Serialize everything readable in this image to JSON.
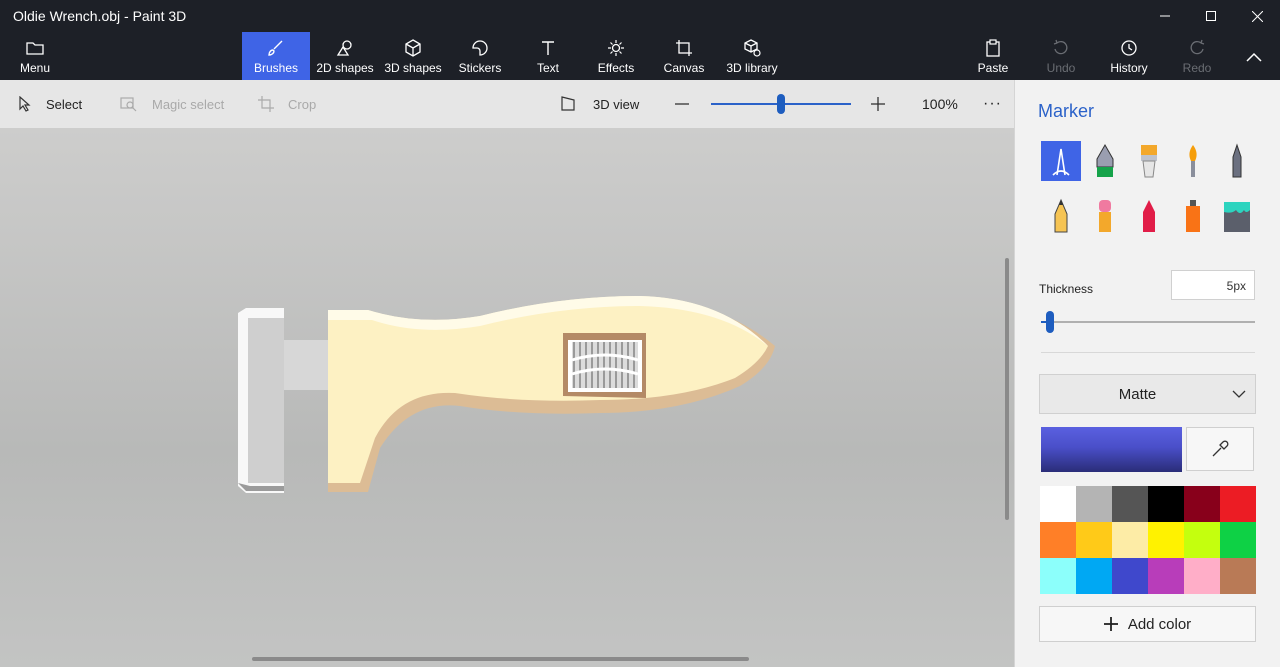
{
  "window": {
    "title": "Oldie Wrench.obj - Paint 3D"
  },
  "ribbon": {
    "menu_label": "Menu",
    "tools": [
      "Brushes",
      "2D shapes",
      "3D shapes",
      "Stickers",
      "Text",
      "Effects",
      "Canvas",
      "3D library"
    ],
    "active_tool": "Brushes",
    "right_tools": [
      "Paste",
      "Undo",
      "History",
      "Redo"
    ]
  },
  "toolbar": {
    "select_label": "Select",
    "magic_select_label": "Magic select",
    "crop_label": "Crop",
    "view3d_label": "3D view",
    "zoom_level": "100%",
    "zoom_slider_fraction": 0.5
  },
  "panel": {
    "title": "Marker",
    "brushes": [
      "marker",
      "calligraphy-pen",
      "oil-brush",
      "watercolor",
      "pixel-pen",
      "pencil",
      "eraser",
      "crayon",
      "spray-can",
      "fill"
    ],
    "selected_brush": "marker",
    "thickness_label": "Thickness",
    "thickness_value": "5px",
    "thickness_fraction": 0.04,
    "finish_value": "Matte",
    "current_color": "#4a4fc9",
    "palette": [
      "#ffffff",
      "#b4b4b4",
      "#555555",
      "#000000",
      "#88001b",
      "#ec1c24",
      "#ff7f27",
      "#ffca18",
      "#fdeca6",
      "#fff200",
      "#c4ff0e",
      "#0ed145",
      "#8cfffb",
      "#00a8f3",
      "#3f48cc",
      "#b83dba",
      "#ffaec8",
      "#b97a56"
    ],
    "add_color_label": "Add color"
  }
}
